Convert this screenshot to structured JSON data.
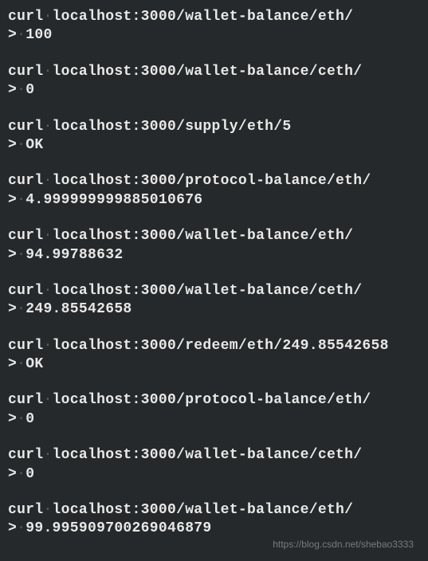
{
  "entries": [
    {
      "command": "curl·localhost:3000/wallet-balance/eth/",
      "output": ">·100"
    },
    {
      "command": "curl·localhost:3000/wallet-balance/ceth/",
      "output": ">·0"
    },
    {
      "command": "curl·localhost:3000/supply/eth/5",
      "output": ">·OK"
    },
    {
      "command": "curl·localhost:3000/protocol-balance/eth/",
      "output": ">·4.999999999885010676"
    },
    {
      "command": "curl·localhost:3000/wallet-balance/eth/",
      "output": ">·94.99788632"
    },
    {
      "command": "curl·localhost:3000/wallet-balance/ceth/",
      "output": ">·249.85542658"
    },
    {
      "command": "curl·localhost:3000/redeem/eth/249.85542658",
      "output": ">·OK"
    },
    {
      "command": "curl·localhost:3000/protocol-balance/eth/",
      "output": ">·0"
    },
    {
      "command": "curl·localhost:3000/wallet-balance/ceth/",
      "output": ">·0"
    },
    {
      "command": "curl·localhost:3000/wallet-balance/eth/",
      "output": ">·99.995909700269046879"
    }
  ],
  "watermark": "https://blog.csdn.net/shebao3333"
}
